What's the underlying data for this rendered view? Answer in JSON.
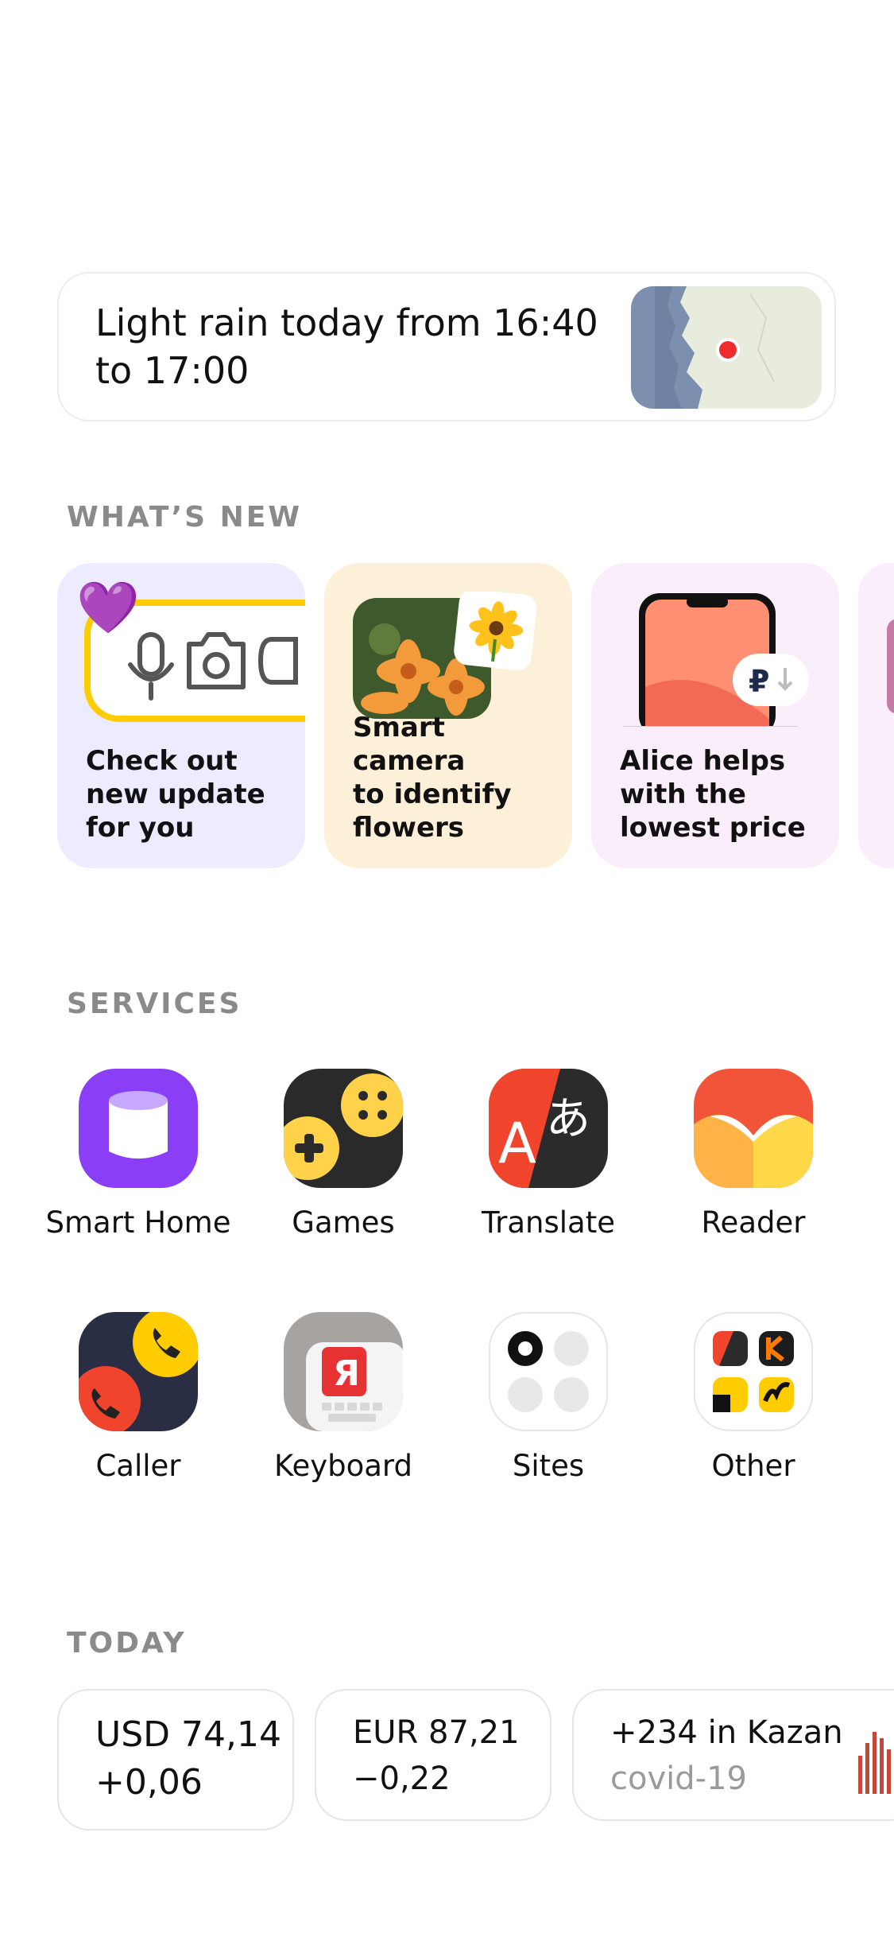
{
  "weather": {
    "text": "Light rain today from 16:40 to 17:00"
  },
  "whats_new": {
    "header": "WHAT’S NEW",
    "stories": [
      {
        "text": "Check out\nnew update\nfor you",
        "bg": "#ecebff"
      },
      {
        "text": "Smart camera\nto identify\nflowers",
        "bg": "#fdf0d9"
      },
      {
        "text": "Alice helps\nwith the\nlowest price",
        "bg": "#fbeefb"
      }
    ]
  },
  "services": {
    "header": "SERVICES",
    "items": [
      {
        "label": "Smart Home",
        "icon": "smart-home-icon"
      },
      {
        "label": "Games",
        "icon": "games-icon"
      },
      {
        "label": "Translate",
        "icon": "translate-icon"
      },
      {
        "label": "Reader",
        "icon": "reader-icon"
      },
      {
        "label": "Caller",
        "icon": "caller-icon"
      },
      {
        "label": "Keyboard",
        "icon": "keyboard-icon"
      },
      {
        "label": "Sites",
        "icon": "sites-icon"
      },
      {
        "label": "Other",
        "icon": "other-icon"
      }
    ]
  },
  "today": {
    "header": "TODAY",
    "cards": [
      {
        "line1": "USD 74,14",
        "line2": "+0,06"
      },
      {
        "line1": "EUR 87,21",
        "line2": "−0,22"
      },
      {
        "line1": "+234 in Kazan",
        "line2": "covid-19"
      }
    ]
  },
  "colors": {
    "purple": "#8a3ff6",
    "yellow": "#ffcc00",
    "red": "#f0442c",
    "covid_bar": "#c7463a"
  }
}
